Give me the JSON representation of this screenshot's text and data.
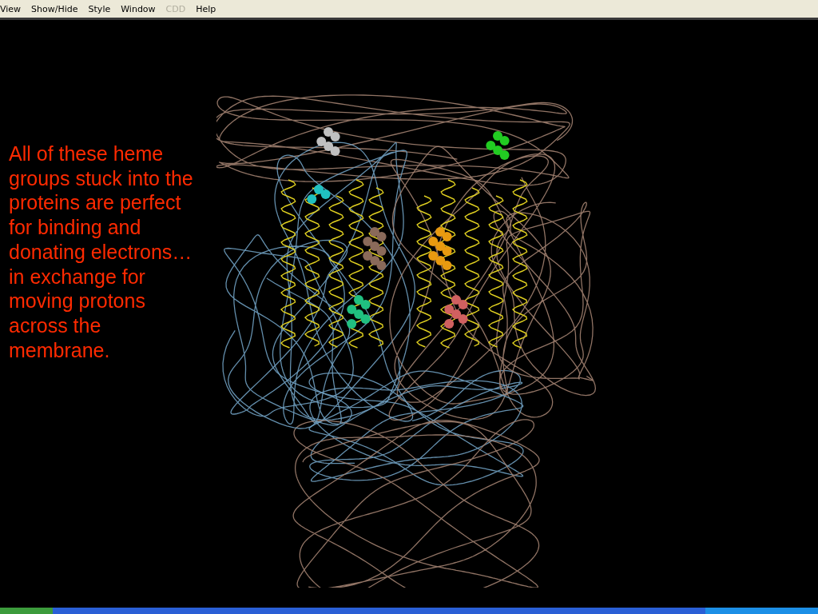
{
  "menu": [
    {
      "label": "View",
      "disabled": false
    },
    {
      "label": "Show/Hide",
      "disabled": false
    },
    {
      "label": "Style",
      "disabled": false
    },
    {
      "label": "Window",
      "disabled": false
    },
    {
      "label": "CDD",
      "disabled": true
    },
    {
      "label": "Help",
      "disabled": false
    }
  ],
  "viewer": {
    "caption": "All of these heme groups stuck into the proteins are perfect for binding and donating electrons… in exchange for moving protons across the membrane."
  }
}
